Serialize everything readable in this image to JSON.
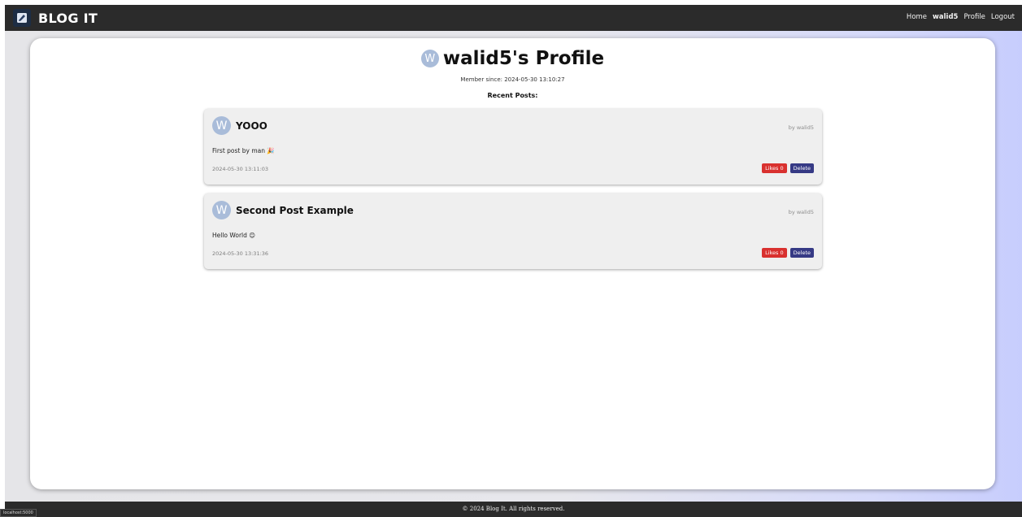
{
  "header": {
    "brand": "BLOG IT",
    "nav": [
      {
        "label": "Home",
        "active": false
      },
      {
        "label": "walid5",
        "active": true
      },
      {
        "label": "Profile",
        "active": false
      },
      {
        "label": "Logout",
        "active": false
      }
    ]
  },
  "profile": {
    "avatar_letter": "W",
    "title": "walid5's Profile",
    "member_since": "Member since: 2024-05-30 13:10:27",
    "recent_posts_label": "Recent Posts:"
  },
  "posts": [
    {
      "avatar_letter": "W",
      "title": "YOOO",
      "author": "by walid5",
      "body": "First post by man 🎉",
      "date": "2024-05-30 13:11:03",
      "likes_label": "Likes 0",
      "delete_label": "Delete"
    },
    {
      "avatar_letter": "W",
      "title": "Second Post Example",
      "author": "by walid5",
      "body": "Hello World 😊",
      "date": "2024-05-30 13:31:36",
      "likes_label": "Likes 0",
      "delete_label": "Delete"
    }
  ],
  "footer": {
    "text": "© 2024 Blog It. All rights reserved."
  },
  "status_bar": {
    "url": "localhost:5000"
  },
  "colors": {
    "topbar": "#2b2b2b",
    "avatar": "#a9bcd9",
    "like_button": "#d9312f",
    "delete_button": "#363a85"
  }
}
